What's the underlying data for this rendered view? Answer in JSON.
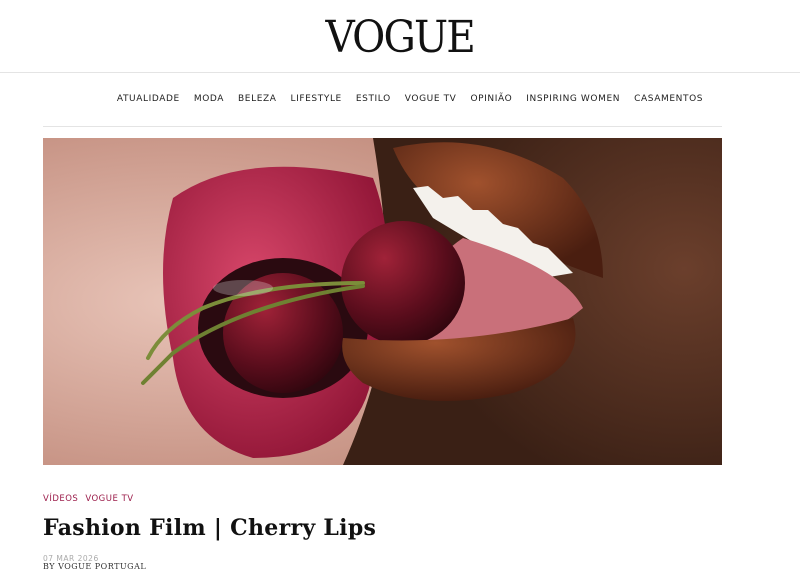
{
  "header": {
    "logo": "VOGUE"
  },
  "nav": {
    "items": [
      {
        "label": "ATUALIDADE"
      },
      {
        "label": "MODA"
      },
      {
        "label": "BELEZA"
      },
      {
        "label": "LIFESTYLE"
      },
      {
        "label": "ESTILO"
      },
      {
        "label": "VOGUE TV"
      },
      {
        "label": "OPINIÃO"
      },
      {
        "label": "INSPIRING WOMEN"
      },
      {
        "label": "CASAMENTOS"
      }
    ]
  },
  "article": {
    "categories": [
      {
        "label": "VÍDEOS"
      },
      {
        "label": "VOGUE TV"
      }
    ],
    "title": "Fashion Film | Cherry Lips",
    "date": "07 MAR 2026",
    "byline": "BY VOGUE PORTUGAL"
  },
  "colors": {
    "accent": "#9b1c4a",
    "text": "#111111",
    "divider": "#e4e4e4"
  }
}
